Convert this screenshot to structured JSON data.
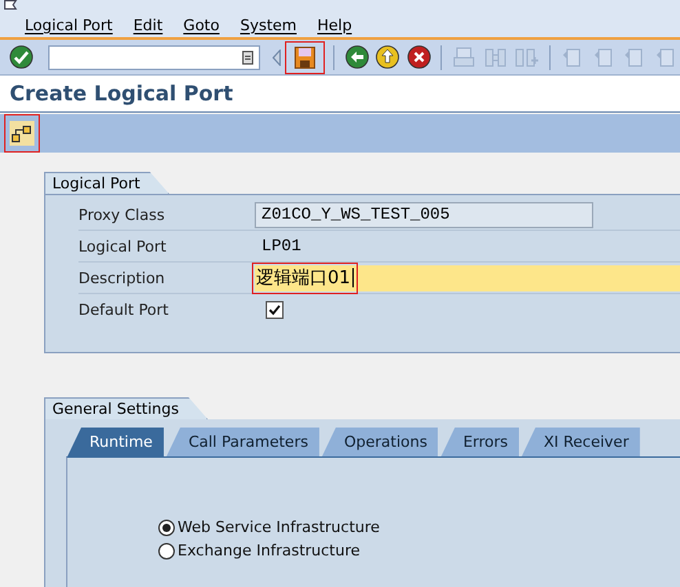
{
  "menu_bar": {
    "items": [
      "Logical Port",
      "Edit",
      "Goto",
      "System",
      "Help"
    ]
  },
  "toolbar": {
    "buttons": [
      {
        "kind": "enter",
        "disabled": false,
        "highlighted": false
      },
      {
        "kind": "command-field"
      },
      {
        "kind": "save",
        "disabled": false,
        "highlighted": true
      },
      {
        "kind": "back",
        "disabled": false,
        "highlighted": false
      },
      {
        "kind": "exit",
        "disabled": false,
        "highlighted": false
      },
      {
        "kind": "cancel",
        "disabled": false,
        "highlighted": false
      },
      {
        "kind": "print",
        "disabled": true,
        "highlighted": false
      },
      {
        "kind": "find",
        "disabled": true,
        "highlighted": false
      },
      {
        "kind": "find-next",
        "disabled": true,
        "highlighted": false
      },
      {
        "kind": "page",
        "disabled": true,
        "highlighted": false
      },
      {
        "kind": "page",
        "disabled": true,
        "highlighted": false
      },
      {
        "kind": "page",
        "disabled": true,
        "highlighted": false
      },
      {
        "kind": "page",
        "disabled": true,
        "highlighted": false
      }
    ]
  },
  "title": "Create Logical Port",
  "app_toolbar": {
    "buttons": [
      {
        "kind": "hierarchy",
        "highlighted": true
      }
    ]
  },
  "logical_port_group": {
    "title": "Logical Port",
    "fields": [
      {
        "kind": "text",
        "label": "Proxy Class",
        "value": "Z01CO_Y_WS_TEST_005",
        "readonly": true,
        "focused": false,
        "highlighted": false
      },
      {
        "kind": "text",
        "label": "Logical Port",
        "value": "LP01",
        "readonly": false,
        "focused": false,
        "highlighted": false
      },
      {
        "kind": "text",
        "label": "Description",
        "value": "逻辑端口01",
        "readonly": false,
        "focused": true,
        "highlighted": true
      },
      {
        "kind": "checkbox",
        "label": "Default Port",
        "checked": true
      }
    ]
  },
  "general_settings": {
    "title": "General Settings",
    "tabs": [
      {
        "label": "Runtime",
        "selected": true
      },
      {
        "label": "Call Parameters",
        "selected": false
      },
      {
        "label": "Operations",
        "selected": false
      },
      {
        "label": "Errors",
        "selected": false
      },
      {
        "label": "XI Receiver",
        "selected": false
      }
    ],
    "options": [
      {
        "label": "Web Service Infrastructure",
        "selected": true
      },
      {
        "label": "Exchange Infrastructure",
        "selected": false
      }
    ]
  }
}
